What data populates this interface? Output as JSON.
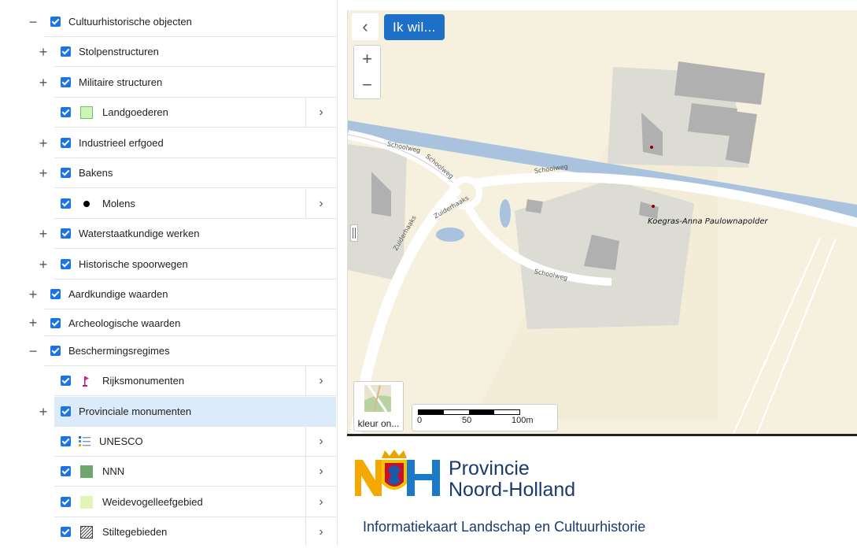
{
  "tree": {
    "rows": [
      {
        "label": "Cultuurhistorische objecten",
        "toggle": "−"
      },
      {
        "label": "Stolpenstructuren",
        "toggle": "+"
      },
      {
        "label": "Militaire structuren",
        "toggle": "+"
      },
      {
        "label": "Landgoederen",
        "symbol": "light-green-square-icon"
      },
      {
        "label": "Industrieel erfgoed",
        "toggle": "+"
      },
      {
        "label": "Bakens",
        "toggle": "+"
      },
      {
        "label": "Molens",
        "symbol": "black-dot-icon"
      },
      {
        "label": "Waterstaatkundige werken",
        "toggle": "+"
      },
      {
        "label": "Historische spoorwegen",
        "toggle": "+"
      },
      {
        "label": "Aardkundige waarden",
        "toggle": "+"
      },
      {
        "label": "Archeologische waarden",
        "toggle": "+"
      },
      {
        "label": "Beschermingsregimes",
        "toggle": "−"
      },
      {
        "label": "Rijksmonumenten",
        "symbol": "pink-flag-icon"
      },
      {
        "label": "Provinciale monumenten",
        "toggle": "+"
      },
      {
        "label": "UNESCO",
        "symbol": "list-legend-icon"
      },
      {
        "label": "NNN",
        "symbol": "green-square-icon"
      },
      {
        "label": "Weidevogelleefgebied",
        "symbol": "pale-green-square-icon"
      },
      {
        "label": "Stiltegebieden",
        "symbol": "hatched-square-icon"
      }
    ],
    "chevron": "›"
  },
  "map": {
    "back": "‹",
    "ik_wil": "Ik wil...",
    "zoom_in": "+",
    "zoom_out": "−",
    "basemap_label": "kleur on...",
    "scale_ticks": [
      "0",
      "50",
      "100m"
    ],
    "place_label": "Koegras-Anna Paulownapolder",
    "road_labels": [
      "Schoolweg",
      "Schoolweg",
      "Schoolweg",
      "Schoolweg",
      "Zuiderhaaks",
      "Zuiderhaaks"
    ]
  },
  "footer": {
    "brand_line1": "Provincie",
    "brand_line2": "Noord-Holland",
    "subtitle": "Informatiekaart Landschap en Cultuurhistorie"
  },
  "colors": {
    "checkbox": "#1a73e8",
    "selected_row": "#dcebfa",
    "ik_wil_button": "#1e6fc8",
    "map_background": "#f6f1df",
    "canal": "#a9c3df",
    "brand_text": "#1a3a6e"
  }
}
